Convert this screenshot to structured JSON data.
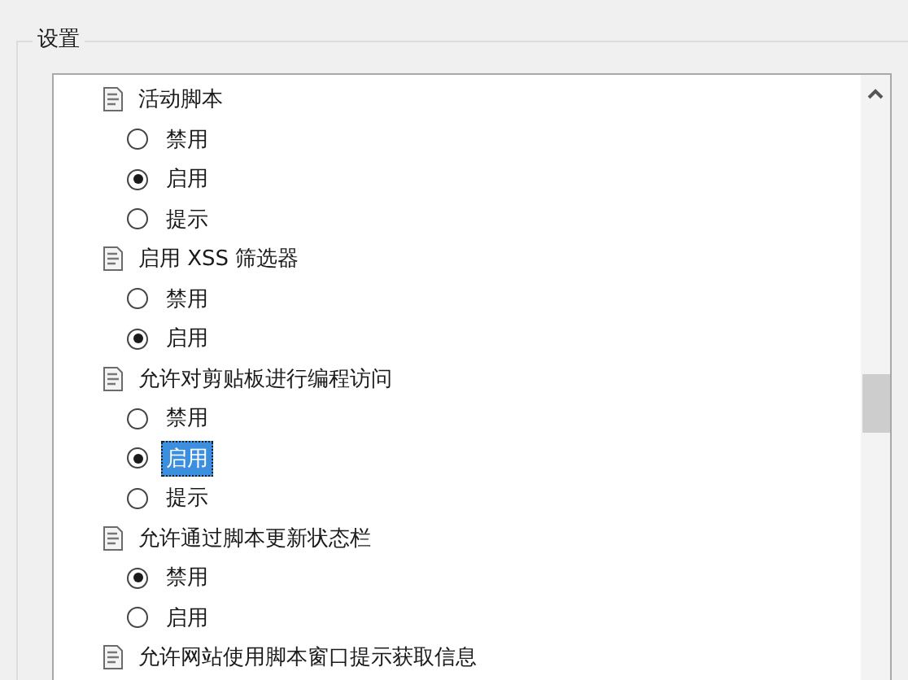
{
  "group": {
    "title": "设置"
  },
  "settings": [
    {
      "title": "活动脚本",
      "options": [
        {
          "label": "禁用",
          "checked": false,
          "selected": false
        },
        {
          "label": "启用",
          "checked": true,
          "selected": false
        },
        {
          "label": "提示",
          "checked": false,
          "selected": false
        }
      ]
    },
    {
      "title": "启用 XSS 筛选器",
      "options": [
        {
          "label": "禁用",
          "checked": false,
          "selected": false
        },
        {
          "label": "启用",
          "checked": true,
          "selected": false
        }
      ]
    },
    {
      "title": "允许对剪贴板进行编程访问",
      "options": [
        {
          "label": "禁用",
          "checked": false,
          "selected": false
        },
        {
          "label": "启用",
          "checked": true,
          "selected": true
        },
        {
          "label": "提示",
          "checked": false,
          "selected": false
        }
      ]
    },
    {
      "title": "允许通过脚本更新状态栏",
      "options": [
        {
          "label": "禁用",
          "checked": true,
          "selected": false
        },
        {
          "label": "启用",
          "checked": false,
          "selected": false
        }
      ]
    },
    {
      "title": "允许网站使用脚本窗口提示获取信息"
    }
  ]
}
